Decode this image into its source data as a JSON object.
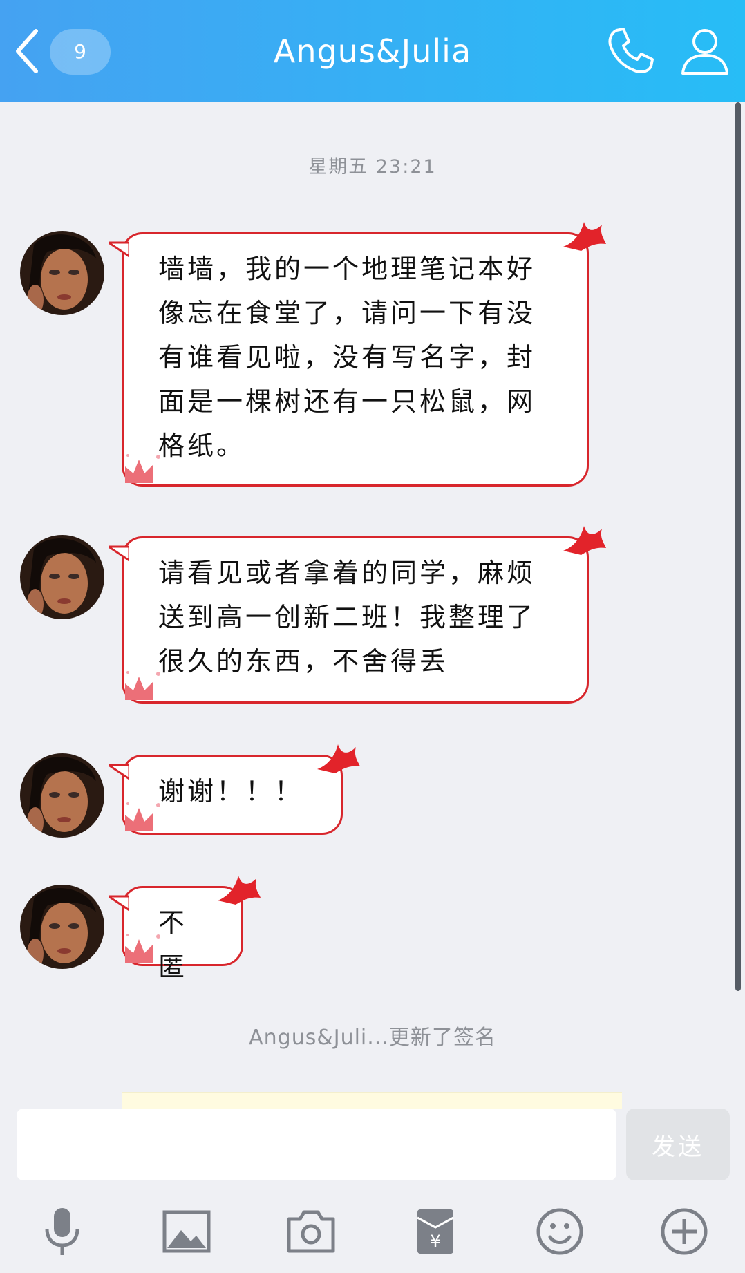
{
  "header": {
    "title": "Angus&Julia",
    "unread_count": "9"
  },
  "chat": {
    "timestamp": "星期五 23:21",
    "messages": [
      {
        "sender": "Angus&Julia",
        "text": "墙墙，我的一个地理笔记本好像忘在食堂了，请问一下有没有谁看见啦，没有写名字，封面是一棵树还有一只松鼠，网格纸。"
      },
      {
        "sender": "Angus&Julia",
        "text": "请看见或者拿着的同学，麻烦送到高一创新二班！我整理了很久的东西，不舍得丢"
      },
      {
        "sender": "Angus&Julia",
        "text": "谢谢！！！"
      },
      {
        "sender": "Angus&Julia",
        "text": "不匿"
      }
    ],
    "system_note": "Angus&Juli...更新了签名"
  },
  "input": {
    "placeholder": "",
    "send_label": "发送"
  },
  "toolbar": {
    "icons": [
      "microphone-icon",
      "image-icon",
      "camera-icon",
      "red-packet-icon",
      "emoji-icon",
      "plus-icon"
    ]
  },
  "colors": {
    "header_start": "#45a2f2",
    "header_end": "#27bdf6",
    "bubble_border": "#d8262c",
    "background": "#eff0f4",
    "toolbar_icon": "#7c8088"
  }
}
